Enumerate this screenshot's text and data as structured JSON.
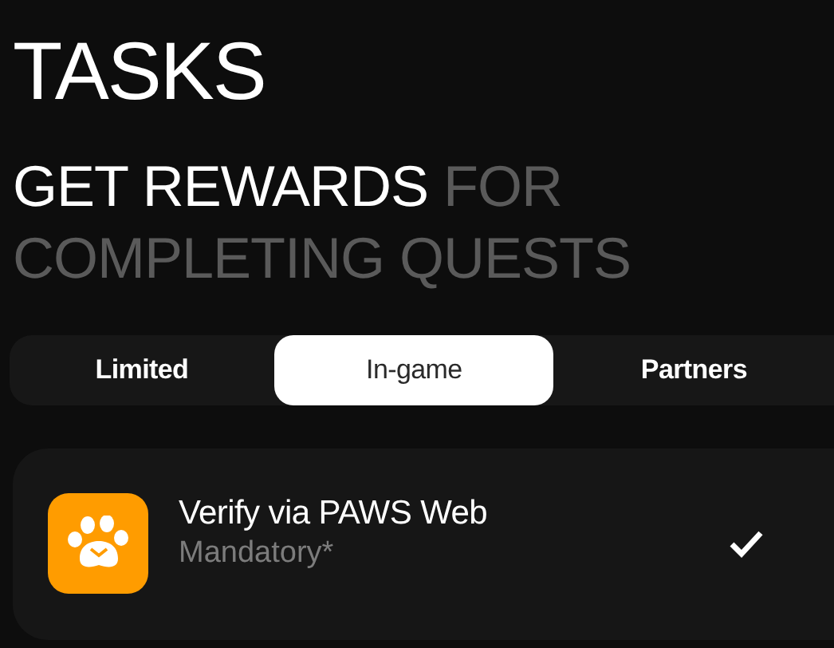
{
  "title": "TASKS",
  "subtitle": {
    "highlight": "GET REWARDS",
    "rest": "FOR COMPLETING QUESTS"
  },
  "tabs": [
    {
      "label": "Limited",
      "selected": false
    },
    {
      "label": "In-game",
      "selected": true
    },
    {
      "label": "Partners",
      "selected": false
    }
  ],
  "tasks": [
    {
      "title": "Verify via PAWS Web",
      "note": "Mandatory*",
      "done": true
    }
  ]
}
